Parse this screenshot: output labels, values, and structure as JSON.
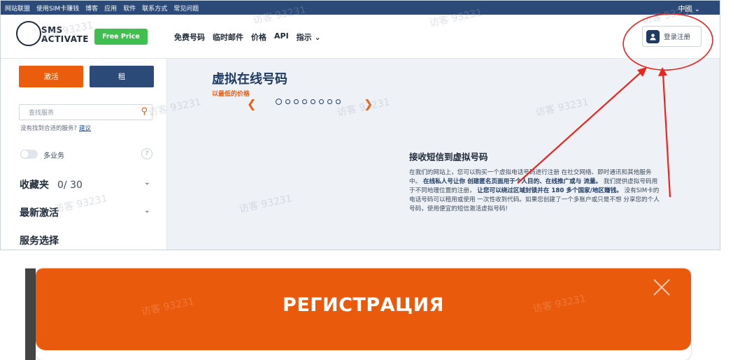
{
  "topbar": {
    "links": [
      "网站联盟",
      "使用SIM卡赚钱",
      "博客",
      "应用",
      "软件",
      "联系方式",
      "常见问题"
    ],
    "language": "中國 ⌄"
  },
  "header": {
    "logo_line1": "SMS",
    "logo_line2": "ACTIVATE",
    "free_price": "Free Price",
    "nav": [
      "免费号码",
      "临时邮件",
      "价格",
      "API",
      "指示 ⌄"
    ],
    "login_label": "登录注册"
  },
  "sidebar": {
    "activate": "激活",
    "rent": "租",
    "search_placeholder": "查找服务",
    "hint": "没有找到合适的服务?",
    "hint_link": "建议",
    "multi_service": "多业务",
    "help": "?",
    "favorites": "收藏夹",
    "favorites_count": "0/ 30",
    "recent": "最新激活",
    "service_select": "服务选择"
  },
  "hero": {
    "title": "虚拟在线号码",
    "subtitle": "以最低的价格",
    "prev": "❮",
    "next": "❯",
    "slides": 8,
    "active_slide": 1
  },
  "content": {
    "title": "接收短信到虚拟号码",
    "p1": "在我们的网站上，您可以购买一个虚拟电话号码进行注册 在社交网络、即时通讯和其他服务中。",
    "p2_bold": "在线私人号让你 创建匿名页面用于个人目的、在线推广或与 流量。",
    "p3": "我们提供虚拟号码用于不同地理位置的注册，",
    "p4_bold": "让您可以绕过区域封锁并在 180 多个国家/地区赚钱。",
    "p5": "没有SIM卡的电话号码可以租用或使用 一次性收到代码。如果您创建了一个多账户或只是不想 分享您的个人号码，使用便宜的短信激活虚拟号码!"
  },
  "watermark": "访客 93231",
  "modal": {
    "title": "РЕГИСТРАЦИЯ"
  },
  "colors": {
    "accent_orange": "#eb5d0d",
    "navy": "#2b4a77",
    "green": "#3fbf4f",
    "annotation_red": "#e8251f"
  }
}
